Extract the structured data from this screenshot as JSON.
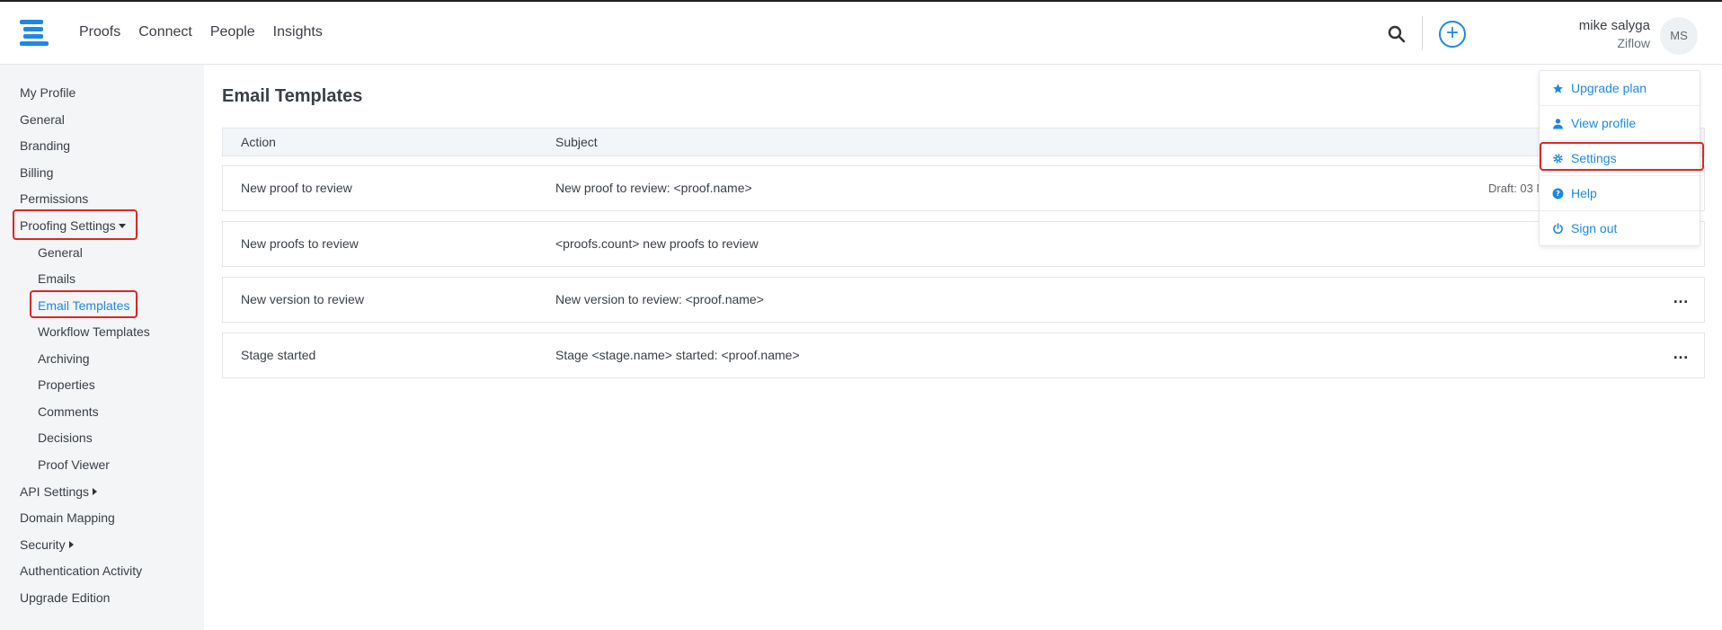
{
  "topnav": {
    "items": [
      "Proofs",
      "Connect",
      "People",
      "Insights"
    ]
  },
  "user": {
    "name": "mike salyga",
    "org": "Ziflow",
    "initials": "MS"
  },
  "sidebar": {
    "items": [
      "My Profile",
      "General",
      "Branding",
      "Billing",
      "Permissions",
      "Proofing Settings",
      "General",
      "Emails",
      "Email Templates",
      "Workflow Templates",
      "Archiving",
      "Properties",
      "Comments",
      "Decisions",
      "Proof Viewer",
      "API Settings",
      "Domain Mapping",
      "Security",
      "Authentication Activity",
      "Upgrade Edition"
    ]
  },
  "main": {
    "title": "Email Templates",
    "columns": {
      "action": "Action",
      "subject": "Subject"
    },
    "rows": [
      {
        "action": "New proof to review",
        "subject": "New proof to review: <proof.name>",
        "draft": "Draft: 03 N"
      },
      {
        "action": "New proofs to review",
        "subject": "<proofs.count> new proofs to review"
      },
      {
        "action": "New version to review",
        "subject": "New version to review: <proof.name>",
        "more": "…"
      },
      {
        "action": "Stage started",
        "subject": "Stage <stage.name> started: <proof.name>",
        "more": "…"
      }
    ]
  },
  "dropdown": {
    "items": [
      {
        "label": "Upgrade plan",
        "icon": "star-icon"
      },
      {
        "label": "View profile",
        "icon": "user-icon"
      },
      {
        "label": "Settings",
        "icon": "gear-icon"
      },
      {
        "label": "Help",
        "icon": "help-icon"
      },
      {
        "label": "Sign out",
        "icon": "power-icon"
      }
    ]
  },
  "colors": {
    "accent": "#1e88e5",
    "highlight": "#e02424",
    "sidebar_bg": "#f3f5f7"
  }
}
